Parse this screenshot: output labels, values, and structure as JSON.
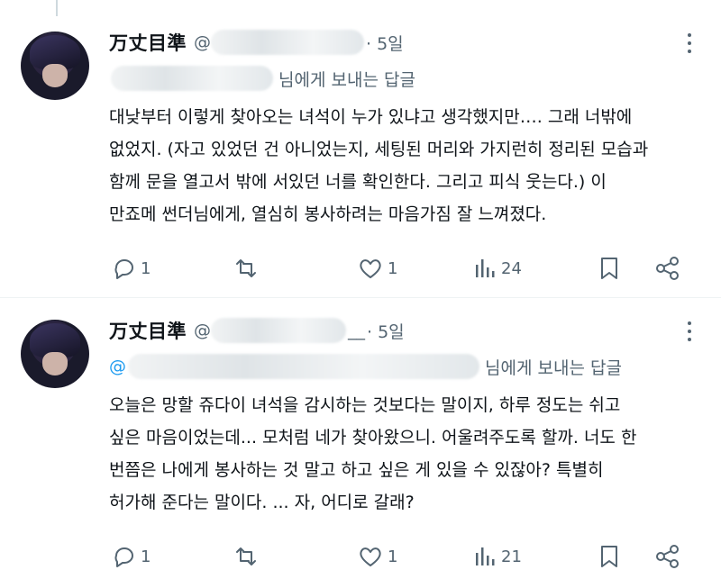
{
  "tweets": [
    {
      "display_name": "万丈目準",
      "handle_prefix": "@",
      "handle_suffix": "",
      "time": "· 5일",
      "reply_suffix": "님에게 보내는 답글",
      "mention_prefix": "",
      "lines": [
        "대낮부터 이렇게 찾아오는 녀석이 누가 있냐고 생각했지만…. 그래 너밖에",
        "없었지. (자고 있었던 건 아니었는지, 세팅된 머리와 가지런히 정리된 모습과",
        "함께 문을 열고서 밖에 서있던 너를 확인한다. 그리고 피식 웃는다.) 이",
        "만죠메 썬더님에게, 열심히 봉사하려는 마음가짐 잘 느껴졌다."
      ],
      "stats": {
        "replies": "1",
        "retweets": "",
        "likes": "1",
        "views": "24"
      }
    },
    {
      "display_name": "万丈目準",
      "handle_prefix": "@",
      "handle_suffix": "__",
      "time": "· 5일",
      "reply_suffix": "님에게 보내는 답글",
      "mention_prefix": "@",
      "lines": [
        "오늘은 망할 쥬다이 녀석을 감시하는 것보다는 말이지, 하루 정도는 쉬고",
        "싶은 마음이었는데... 모처럼 네가 찾아왔으니. 어울려주도록 할까. 너도 한",
        "번쯤은 나에게 봉사하는 것 말고 하고 싶은 게 있을 수 있잖아? 특별히",
        "허가해 준다는 말이다. ... 자, 어디로 갈래?"
      ],
      "stats": {
        "replies": "1",
        "retweets": "",
        "likes": "1",
        "views": "21"
      }
    }
  ],
  "icons": {
    "reply": "reply-icon",
    "retweet": "retweet-icon",
    "like": "heart-icon",
    "views": "views-icon",
    "bookmark": "bookmark-icon",
    "share": "share-icon",
    "more": "more-icon"
  },
  "colors": {
    "text": "#0f1419",
    "muted": "#536471",
    "link": "#1d9bf0",
    "divider": "#eff3f4"
  }
}
